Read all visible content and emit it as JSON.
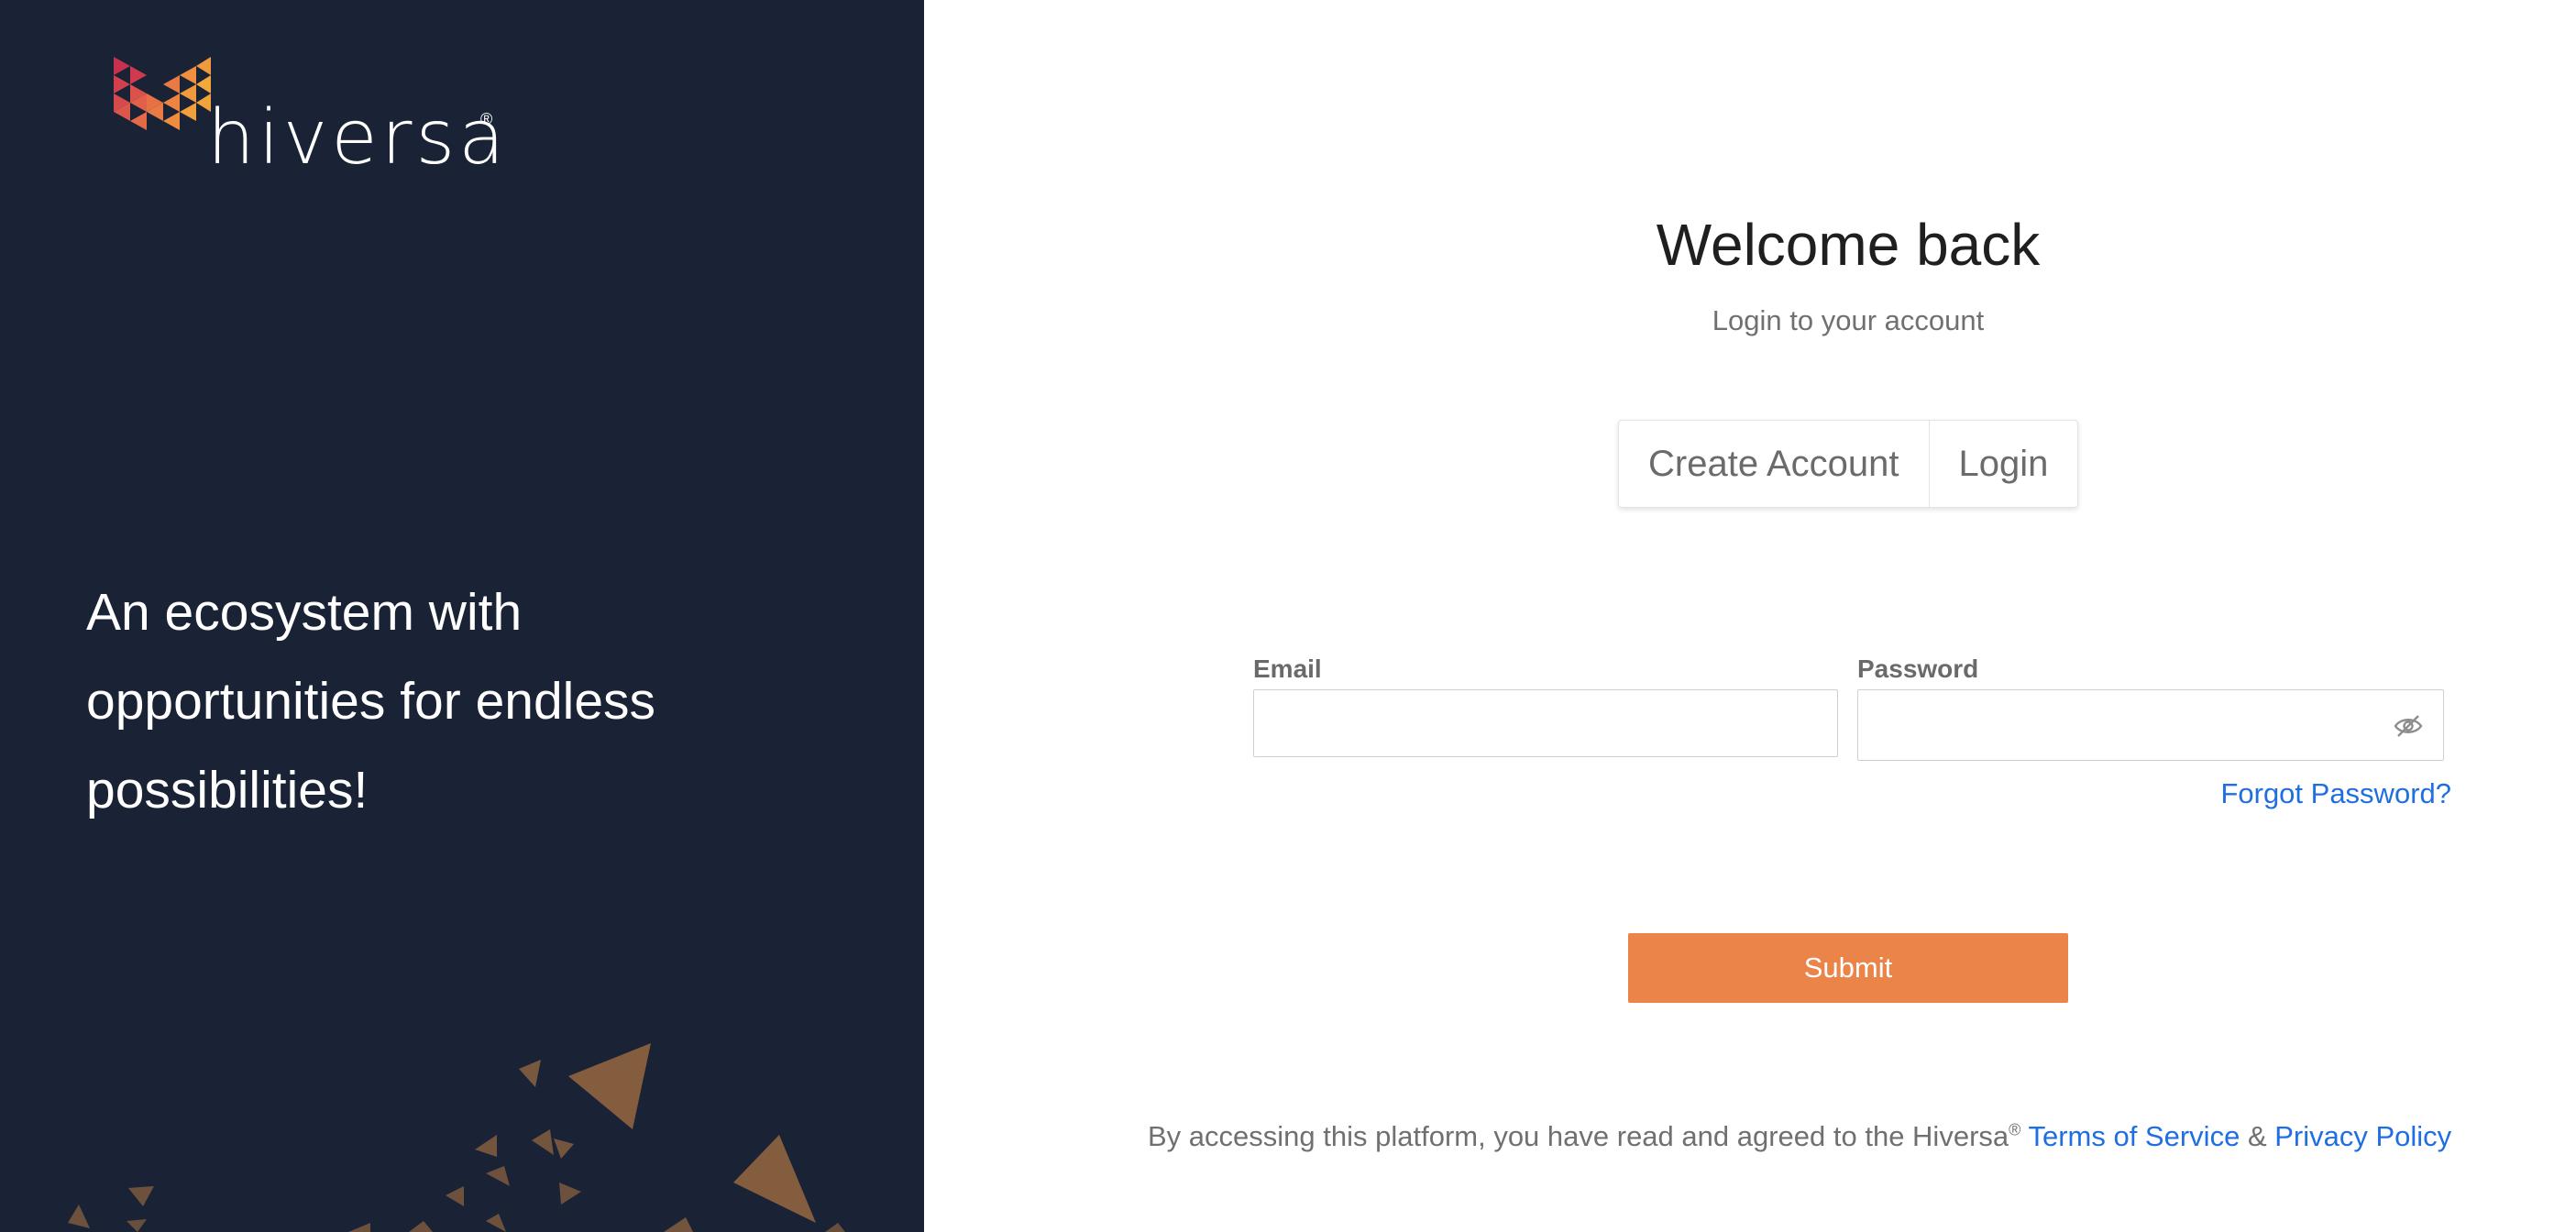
{
  "brand": {
    "name": "hiversa",
    "registered_mark": "®",
    "mark_colors": [
      "#c7314f",
      "#e0604a",
      "#f09a3e"
    ]
  },
  "left_panel": {
    "tagline_lines": [
      "An ecosystem with",
      "opportunities for endless",
      "possibilities!"
    ],
    "background_color": "#1a2235",
    "triangle_color": "#8a6140"
  },
  "auth": {
    "title": "Welcome back",
    "subtitle": "Login to your account",
    "tabs": [
      {
        "label": "Create Account"
      },
      {
        "label": "Login"
      }
    ],
    "email_label": "Email",
    "email_value": "",
    "password_label": "Password",
    "password_value": "",
    "password_toggle_icon": "eye-slash-icon",
    "forgot_password": "Forgot Password?",
    "submit_label": "Submit",
    "submit_color": "#ea8448",
    "link_color": "#1f6fe0"
  },
  "footer": {
    "prefix": "By accessing this platform, you have read and agreed to the Hiversa",
    "registered_mark": "®",
    "terms_label": "Terms of Service",
    "conjunction": "&",
    "privacy_label": "Privacy Policy"
  }
}
